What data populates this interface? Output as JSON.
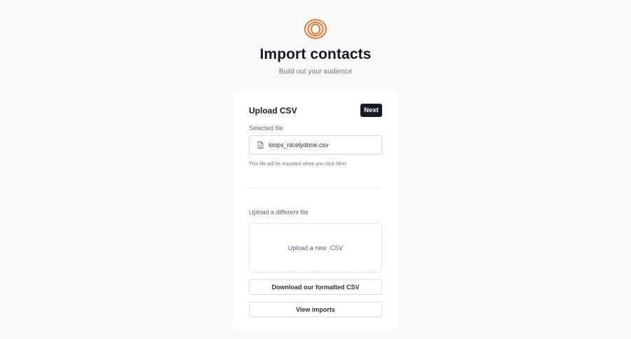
{
  "header": {
    "logo_icon": "concentric-rings-logo",
    "brand_color": "#e8772e",
    "title": "Import contacts",
    "subtitle": "Build out your audience"
  },
  "card": {
    "title": "Upload CSV",
    "next_label": "Next",
    "selected_file_label": "Selected file",
    "file_icon": "file-icon",
    "selected_file_name": "loops_nicelydone.csv",
    "hint": "This file will be imported when you click Next",
    "different_file_label": "Upload a different file",
    "dropzone_text": "Upload a new .CSV",
    "download_label": "Download our formatted CSV",
    "view_imports_label": "View imports"
  }
}
